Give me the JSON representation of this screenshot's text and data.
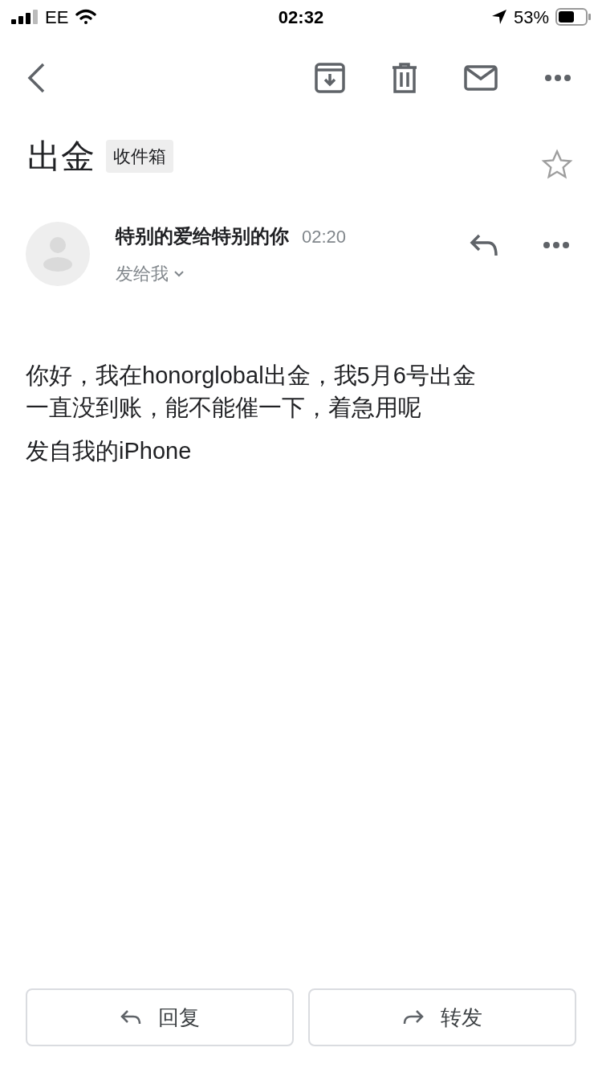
{
  "status_bar": {
    "carrier": "EE",
    "time": "02:32",
    "battery": "53%"
  },
  "subject": {
    "title": "出金",
    "label": "收件箱",
    "starred": false
  },
  "message": {
    "sender": "特别的爱给特别的你",
    "time": "02:20",
    "recipient": "发给我",
    "body_lines": [
      "你好，我在honorglobal出金，我5月6号出金",
      "一直没到账，能不能催一下，着急用呢"
    ],
    "signature": "发自我的iPhone"
  },
  "actions": [
    {
      "kind": "reply",
      "label": "回复"
    },
    {
      "kind": "forward",
      "label": "转发"
    }
  ]
}
